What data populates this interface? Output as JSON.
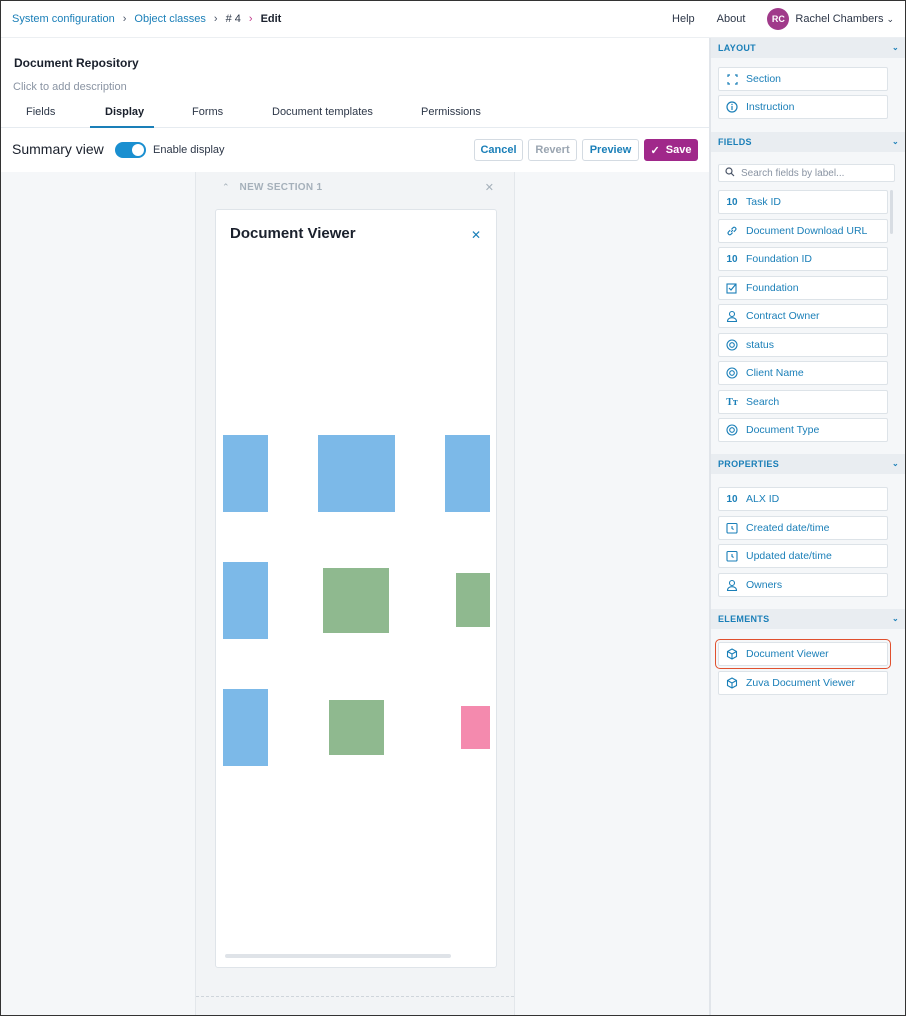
{
  "breadcrumb": {
    "items": [
      "System configuration",
      "Object classes",
      "# 4"
    ],
    "current": "Edit"
  },
  "topnav": {
    "help": "Help",
    "about": "About",
    "avatar_initials": "RC",
    "user_name": "Rachel Chambers"
  },
  "page": {
    "title": "Document Repository",
    "description_placeholder": "Click to add description"
  },
  "tabs": [
    {
      "label": "Fields",
      "active": false
    },
    {
      "label": "Display",
      "active": true
    },
    {
      "label": "Forms",
      "active": false
    },
    {
      "label": "Document templates",
      "active": false
    },
    {
      "label": "Permissions",
      "active": false
    }
  ],
  "summary": {
    "label": "Summary view",
    "toggle_label": "Enable display",
    "enabled": true
  },
  "actions": {
    "cancel": "Cancel",
    "revert": "Revert",
    "preview": "Preview",
    "save": "Save"
  },
  "canvas": {
    "section_title": "NEW SECTION 1",
    "viewer_title": "Document Viewer"
  },
  "sidebar": {
    "layout": {
      "title": "LAYOUT",
      "items": [
        {
          "label": "Section",
          "icon": "section-icon"
        },
        {
          "label": "Instruction",
          "icon": "info-icon"
        }
      ]
    },
    "fields": {
      "title": "FIELDS",
      "search_placeholder": "Search fields by label...",
      "items": [
        {
          "label": "Task ID",
          "icon": "id-icon"
        },
        {
          "label": "Document Download URL",
          "icon": "link-icon"
        },
        {
          "label": "Foundation ID",
          "icon": "id-icon"
        },
        {
          "label": "Foundation",
          "icon": "checkbox-icon"
        },
        {
          "label": "Contract Owner",
          "icon": "user-icon"
        },
        {
          "label": "status",
          "icon": "select-icon"
        },
        {
          "label": "Client Name",
          "icon": "select-icon"
        },
        {
          "label": "Search",
          "icon": "text-icon"
        },
        {
          "label": "Document Type",
          "icon": "select-icon"
        }
      ]
    },
    "properties": {
      "title": "PROPERTIES",
      "items": [
        {
          "label": "ALX ID",
          "icon": "id-icon"
        },
        {
          "label": "Created date/time",
          "icon": "clock-icon"
        },
        {
          "label": "Updated date/time",
          "icon": "clock-icon"
        },
        {
          "label": "Owners",
          "icon": "user-icon"
        }
      ]
    },
    "elements": {
      "title": "ELEMENTS",
      "items": [
        {
          "label": "Document Viewer",
          "icon": "cube-icon"
        },
        {
          "label": "Zuva Document Viewer",
          "icon": "cube-icon"
        }
      ]
    }
  },
  "colors": {
    "accent": "#1a7fb8",
    "save": "#a0288a",
    "highlight": "#e0502e",
    "placeholder_blue": "#7cb9e8",
    "placeholder_green": "#8fb98f",
    "placeholder_pink": "#f48aae"
  }
}
